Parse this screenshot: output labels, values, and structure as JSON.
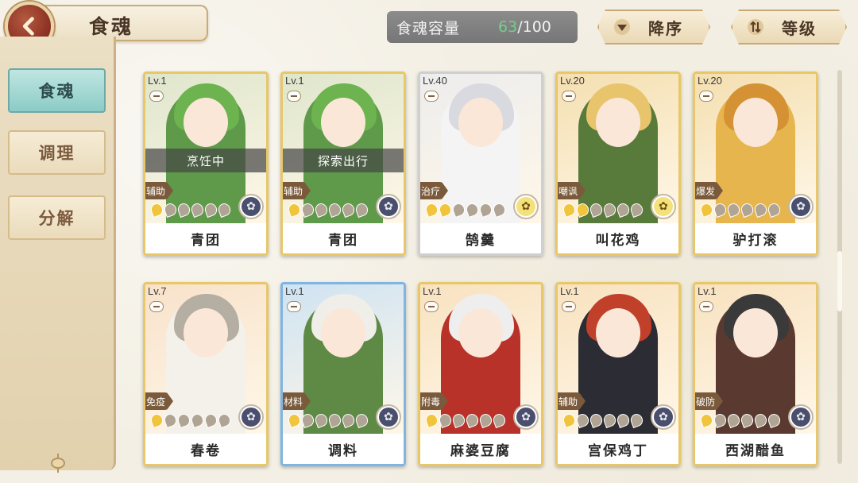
{
  "header": {
    "title": "食魂",
    "back_icon": "chevron-left-icon",
    "capacity_label": "食魂容量",
    "capacity_current": "63",
    "capacity_max": "/100",
    "sort_label": "降序",
    "sort_icon": "triangle-down-icon",
    "level_label": "等级",
    "level_icon": "sort-arrows-icon"
  },
  "sidebar": {
    "tabs": [
      {
        "label": "食魂",
        "active": true
      },
      {
        "label": "调理",
        "active": false
      },
      {
        "label": "分解",
        "active": false
      }
    ]
  },
  "cards": [
    {
      "level": "Lv.1",
      "name": "青团",
      "role": "辅助",
      "status": "烹饪中",
      "stars": 1,
      "frame": "gold",
      "palette": [
        "#dfe6cc",
        "#5e9a4a",
        "#6db34f"
      ],
      "emblem": "dark"
    },
    {
      "level": "Lv.1",
      "name": "青团",
      "role": "辅助",
      "status": "探索出行",
      "stars": 1,
      "frame": "gold",
      "palette": [
        "#dfe6cc",
        "#5e9a4a",
        "#6db34f"
      ],
      "emblem": "dark"
    },
    {
      "level": "Lv.40",
      "name": "鹄羹",
      "role": "治疗",
      "status": "",
      "stars": 2,
      "frame": "grey",
      "palette": [
        "#ededed",
        "#f4f4f4",
        "#d9d9e0"
      ],
      "emblem": "gold"
    },
    {
      "level": "Lv.20",
      "name": "叫花鸡",
      "role": "嘲讽",
      "status": "",
      "stars": 2,
      "frame": "gold",
      "palette": [
        "#f4dfb0",
        "#587a3a",
        "#e8c46c"
      ],
      "emblem": "gold"
    },
    {
      "level": "Lv.20",
      "name": "驴打滚",
      "role": "爆发",
      "status": "",
      "stars": 1,
      "frame": "gold",
      "palette": [
        "#f4dfb0",
        "#e7b54e",
        "#d49234"
      ],
      "emblem": "dark"
    },
    {
      "level": "Lv.7",
      "name": "春卷",
      "role": "免疫",
      "status": "",
      "stars": 1,
      "frame": "gold",
      "palette": [
        "#f8e2cb",
        "#f4f1ea",
        "#b5aea2"
      ],
      "emblem": "dark"
    },
    {
      "level": "Lv.1",
      "name": "调料",
      "role": "材料",
      "status": "",
      "stars": 1,
      "frame": "blue",
      "palette": [
        "#cfe3f2",
        "#5e8a45",
        "#efeee8"
      ],
      "emblem": "dark"
    },
    {
      "level": "Lv.1",
      "name": "麻婆豆腐",
      "role": "附毒",
      "status": "",
      "stars": 1,
      "frame": "gold",
      "palette": [
        "#f8e2c0",
        "#b8322a",
        "#eeeeee"
      ],
      "emblem": "dark"
    },
    {
      "level": "Lv.1",
      "name": "宫保鸡丁",
      "role": "辅助",
      "status": "",
      "stars": 1,
      "frame": "gold",
      "palette": [
        "#f8e2c0",
        "#2c2c34",
        "#c0402a"
      ],
      "emblem": "dark"
    },
    {
      "level": "Lv.1",
      "name": "西湖醋鱼",
      "role": "破防",
      "status": "",
      "stars": 1,
      "frame": "gold",
      "palette": [
        "#f8e2c0",
        "#5a3a30",
        "#3a3a3a"
      ],
      "emblem": "dark"
    }
  ]
}
